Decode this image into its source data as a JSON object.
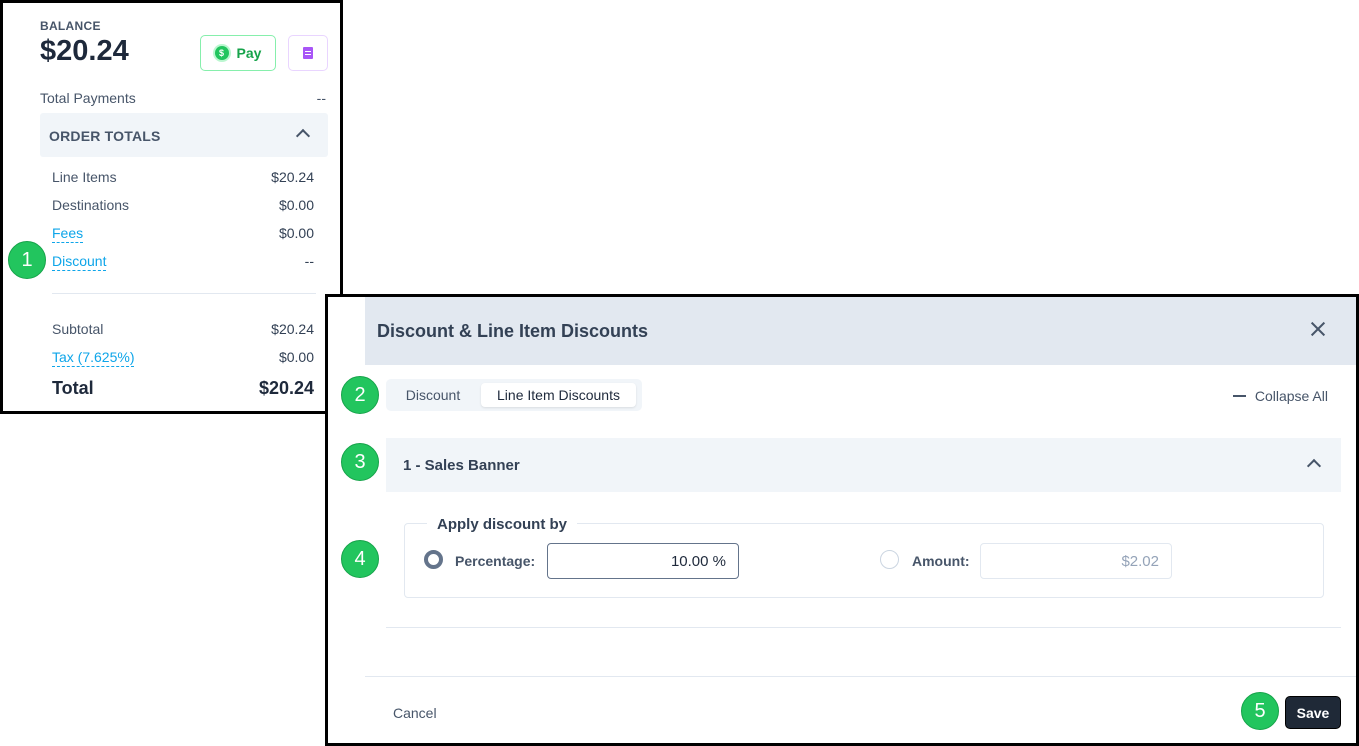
{
  "balance": {
    "label": "BALANCE",
    "amount": "$20.24",
    "pay_label": "Pay",
    "pay_icon": "dollar-circle-icon",
    "doc_icon": "document-icon"
  },
  "payments": {
    "label": "Total Payments",
    "value": "--"
  },
  "order_totals": {
    "title": "ORDER TOTALS",
    "rows": [
      {
        "label": "Line Items",
        "value": "$20.24"
      },
      {
        "label": "Destinations",
        "value": "$0.00"
      },
      {
        "label": "Fees",
        "value": "$0.00"
      },
      {
        "label": "Discount",
        "value": "--"
      }
    ],
    "subtotal": {
      "label": "Subtotal",
      "value": "$20.24"
    },
    "tax": {
      "label": "Tax (7.625%)",
      "value": "$0.00"
    },
    "total": {
      "label": "Total",
      "value": "$20.24"
    }
  },
  "badges": [
    "1",
    "2",
    "3",
    "4",
    "5"
  ],
  "modal": {
    "title": "Discount & Line Item Discounts",
    "tabs": [
      {
        "label": "Discount",
        "active": false
      },
      {
        "label": "Line Item Discounts",
        "active": true
      }
    ],
    "collapse_all": "Collapse All",
    "item_title": "1 - Sales Banner",
    "apply_label": "Apply discount by",
    "percentage": {
      "label": "Percentage:",
      "value": "10.00 %",
      "selected": true
    },
    "amount": {
      "label": "Amount:",
      "placeholder": "$2.02",
      "selected": false
    },
    "cancel": "Cancel",
    "save": "Save"
  },
  "colors": {
    "accent_green": "#22c55e",
    "link_blue": "#0ea5e9",
    "header_bg": "#e2e8f0",
    "save_bg": "#1f2937"
  }
}
